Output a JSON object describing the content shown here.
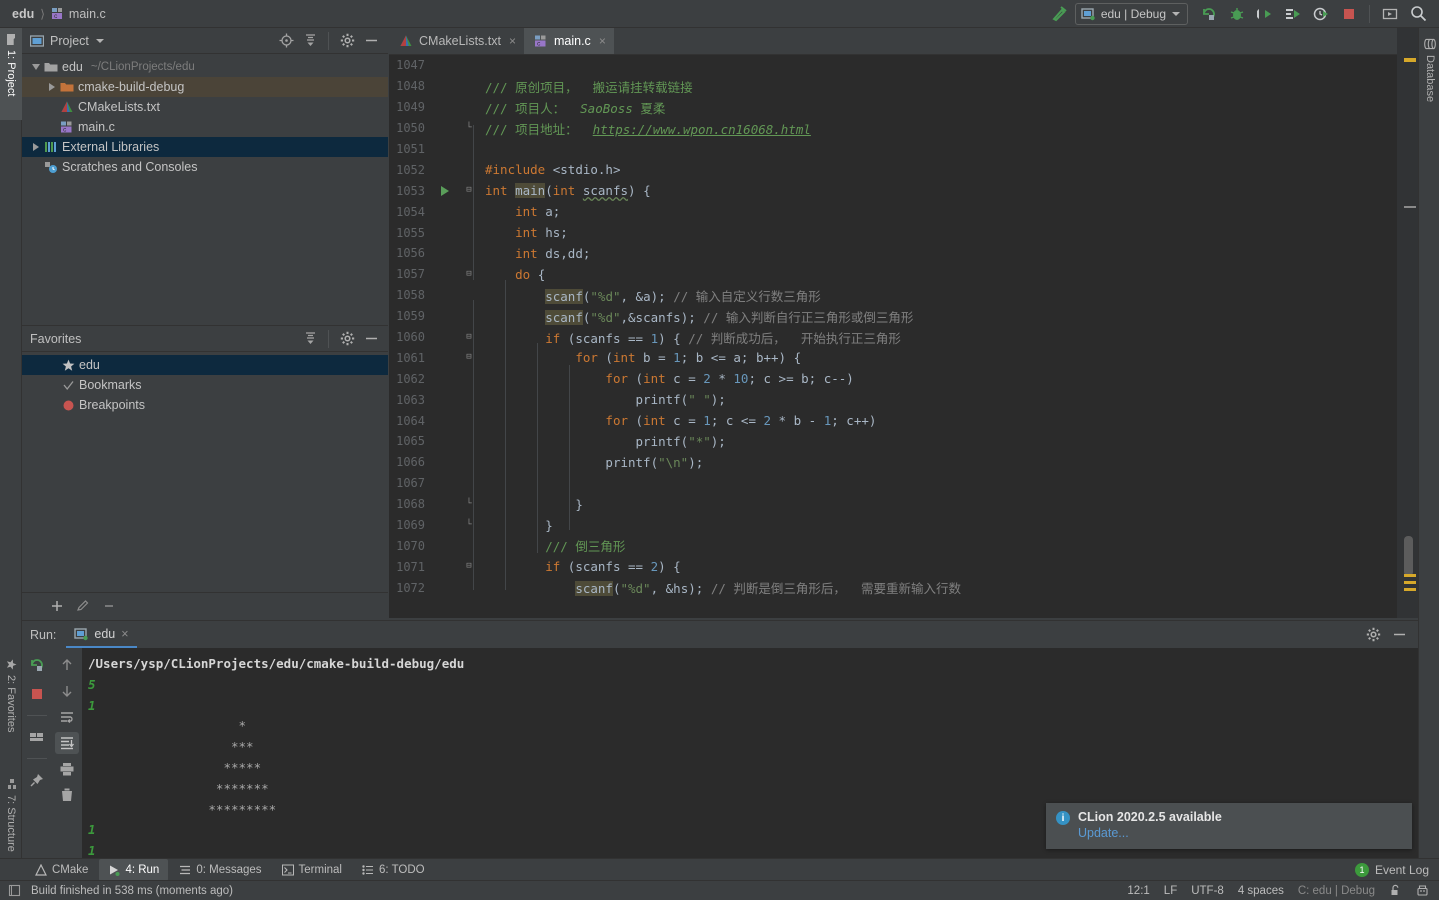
{
  "window": {
    "breadcrumb": [
      {
        "label": "edu",
        "icon": "project-icon",
        "bold": true
      },
      {
        "label": "main.c",
        "icon": "c-file-icon",
        "bold": false
      }
    ]
  },
  "toolbar": {
    "build_icon": "hammer-icon",
    "run_config": {
      "label": "edu | Debug",
      "icon": "run-config-icon",
      "caret": "chevron-down-icon"
    },
    "buttons": [
      {
        "name": "rerun-icon",
        "title": "Rerun"
      },
      {
        "name": "debug-icon",
        "title": "Debug"
      },
      {
        "name": "run-with-coverage-icon",
        "title": "Run with Coverage"
      },
      {
        "name": "profile-icon",
        "title": "Profile"
      },
      {
        "name": "attach-profiler-icon",
        "title": "Attach Profiler"
      },
      {
        "name": "stop-icon",
        "title": "Stop"
      },
      {
        "name": "hide-window-icon",
        "title": "Hide"
      },
      {
        "name": "search-icon",
        "title": "Search Everywhere"
      }
    ]
  },
  "left_strip": {
    "tabs": [
      {
        "label": "1: Project",
        "icon": "project-folder-icon",
        "active": true
      },
      {
        "label": "2: Favorites",
        "icon": "star-icon",
        "active": false
      },
      {
        "label": "7: Structure",
        "icon": "structure-icon",
        "active": false
      }
    ]
  },
  "right_strip": {
    "tabs": [
      {
        "label": "Database",
        "icon": "database-icon",
        "active": false
      }
    ]
  },
  "project_panel": {
    "title": "Project",
    "title_caret": "chevron-down-icon",
    "header_icons": [
      "locate-icon",
      "collapse-all-icon",
      "gear-icon",
      "minimize-icon"
    ],
    "tree": [
      {
        "label": "edu",
        "sub": "~/CLionProjects/edu",
        "icon": "folder-icon",
        "twisty": "down",
        "indent": 0,
        "state": "none"
      },
      {
        "label": "cmake-build-debug",
        "sub": "",
        "icon": "excluded-folder-icon",
        "twisty": "right",
        "indent": 1,
        "state": "soft"
      },
      {
        "label": "CMakeLists.txt",
        "sub": "",
        "icon": "cmake-icon",
        "twisty": "none",
        "indent": 1,
        "state": "none"
      },
      {
        "label": "main.c",
        "sub": "",
        "icon": "c-file-icon",
        "twisty": "none",
        "indent": 1,
        "state": "none"
      },
      {
        "label": "External Libraries",
        "sub": "",
        "icon": "libraries-icon",
        "twisty": "right",
        "indent": 0,
        "state": "blue"
      },
      {
        "label": "Scratches and Consoles",
        "sub": "",
        "icon": "scratches-icon",
        "twisty": "none",
        "indent": 0,
        "state": "none"
      }
    ],
    "bottom_buttons": [
      "add-icon",
      "edit-icon",
      "remove-icon"
    ]
  },
  "favorites_panel": {
    "title": "Favorites",
    "header_icons": [
      "collapse-all-icon",
      "gear-icon",
      "minimize-icon"
    ],
    "items": [
      {
        "label": "edu",
        "icon": "star-icon",
        "state": "blue"
      },
      {
        "label": "Bookmarks",
        "icon": "check-icon",
        "state": "none"
      },
      {
        "label": "Breakpoints",
        "icon": "breakpoint-icon",
        "state": "none"
      }
    ]
  },
  "editor": {
    "tabs": [
      {
        "label": "CMakeLists.txt",
        "icon": "cmake-icon",
        "active": false,
        "close": "×"
      },
      {
        "label": "main.c",
        "icon": "c-file-icon",
        "active": true,
        "close": "×"
      }
    ],
    "first_line": 1047,
    "lines": [
      {
        "num": 1047,
        "fold": "",
        "gutter": "",
        "blank": true,
        "tokens": []
      },
      {
        "num": 1048,
        "fold": "",
        "gutter": "",
        "indent": 0,
        "tokens": [
          {
            "t": "/// 原创项目，  搬运请挂转载链接",
            "c": "doc"
          }
        ]
      },
      {
        "num": 1049,
        "fold": "",
        "gutter": "",
        "indent": 0,
        "tokens": [
          {
            "t": "/// 项目人：  ",
            "c": "doc"
          },
          {
            "t": "SaoBoss",
            "c": "doci"
          },
          {
            "t": " 夏柔",
            "c": "doc"
          }
        ]
      },
      {
        "num": 1050,
        "fold": "end",
        "gutter": "",
        "indent": 0,
        "tokens": [
          {
            "t": "/// 项目地址：  ",
            "c": "doc"
          },
          {
            "t": "https://www.wpon.cn16068.html",
            "c": "lnk"
          }
        ]
      },
      {
        "num": 1051,
        "fold": "",
        "gutter": "",
        "blank": true,
        "tokens": []
      },
      {
        "num": 1052,
        "fold": "",
        "gutter": "",
        "indent": 0,
        "tokens": [
          {
            "t": "#include",
            "c": "k"
          },
          {
            "t": " <stdio.h>",
            "c": "id"
          }
        ]
      },
      {
        "num": 1053,
        "fold": "start",
        "gutter": "run",
        "indent": 0,
        "tokens": [
          {
            "t": "int",
            "c": "k"
          },
          {
            "t": " ",
            "c": "id"
          },
          {
            "t": "main",
            "c": "hl"
          },
          {
            "t": "(",
            "c": "id"
          },
          {
            "t": "int",
            "c": "k"
          },
          {
            "t": " ",
            "c": "id"
          },
          {
            "t": "scanfs",
            "c": "err"
          },
          {
            "t": ") {",
            "c": "id"
          }
        ]
      },
      {
        "num": 1054,
        "fold": "",
        "gutter": "",
        "indent": 1,
        "tokens": [
          {
            "t": "int",
            "c": "k"
          },
          {
            "t": " a;",
            "c": "id"
          }
        ]
      },
      {
        "num": 1055,
        "fold": "",
        "gutter": "",
        "indent": 1,
        "tokens": [
          {
            "t": "int",
            "c": "k"
          },
          {
            "t": " hs;",
            "c": "id"
          }
        ]
      },
      {
        "num": 1056,
        "fold": "",
        "gutter": "",
        "indent": 1,
        "tokens": [
          {
            "t": "int",
            "c": "k"
          },
          {
            "t": " ds,dd;",
            "c": "id"
          }
        ]
      },
      {
        "num": 1057,
        "fold": "start",
        "gutter": "",
        "indent": 1,
        "tokens": [
          {
            "t": "do",
            "c": "k"
          },
          {
            "t": " {",
            "c": "id"
          }
        ]
      },
      {
        "num": 1058,
        "fold": "",
        "gutter": "",
        "indent": 2,
        "tokens": [
          {
            "t": "scanf",
            "c": "hl"
          },
          {
            "t": "(",
            "c": "id"
          },
          {
            "t": "\"%d\"",
            "c": "s"
          },
          {
            "t": ", &a); ",
            "c": "id"
          },
          {
            "t": "// 输入自定义行数三角形",
            "c": "c"
          }
        ]
      },
      {
        "num": 1059,
        "fold": "",
        "gutter": "",
        "indent": 2,
        "tokens": [
          {
            "t": "scanf",
            "c": "hl"
          },
          {
            "t": "(",
            "c": "id"
          },
          {
            "t": "\"%d\"",
            "c": "s"
          },
          {
            "t": ",&scanfs); ",
            "c": "id"
          },
          {
            "t": "// 输入判断自行正三角形或倒三角形",
            "c": "c"
          }
        ]
      },
      {
        "num": 1060,
        "fold": "start",
        "gutter": "",
        "indent": 2,
        "tokens": [
          {
            "t": "if",
            "c": "k"
          },
          {
            "t": " (scanfs == ",
            "c": "id"
          },
          {
            "t": "1",
            "c": "n"
          },
          {
            "t": ") { ",
            "c": "id"
          },
          {
            "t": "// 判断成功后，  开始执行正三角形",
            "c": "c"
          }
        ]
      },
      {
        "num": 1061,
        "fold": "start",
        "gutter": "",
        "indent": 3,
        "tokens": [
          {
            "t": "for",
            "c": "k"
          },
          {
            "t": " (",
            "c": "id"
          },
          {
            "t": "int",
            "c": "k"
          },
          {
            "t": " b = ",
            "c": "id"
          },
          {
            "t": "1",
            "c": "n"
          },
          {
            "t": "; b <= a; b++) {",
            "c": "id"
          }
        ]
      },
      {
        "num": 1062,
        "fold": "",
        "gutter": "",
        "indent": 4,
        "tokens": [
          {
            "t": "for",
            "c": "k"
          },
          {
            "t": " (",
            "c": "id"
          },
          {
            "t": "int",
            "c": "k"
          },
          {
            "t": " c = ",
            "c": "id"
          },
          {
            "t": "2",
            "c": "n"
          },
          {
            "t": " * ",
            "c": "id"
          },
          {
            "t": "10",
            "c": "n"
          },
          {
            "t": "; c >= b; c--)",
            "c": "id"
          }
        ]
      },
      {
        "num": 1063,
        "fold": "",
        "gutter": "",
        "indent": 5,
        "tokens": [
          {
            "t": "printf(",
            "c": "id"
          },
          {
            "t": "\" \"",
            "c": "s"
          },
          {
            "t": ");",
            "c": "id"
          }
        ]
      },
      {
        "num": 1064,
        "fold": "",
        "gutter": "",
        "indent": 4,
        "tokens": [
          {
            "t": "for",
            "c": "k"
          },
          {
            "t": " (",
            "c": "id"
          },
          {
            "t": "int",
            "c": "k"
          },
          {
            "t": " c = ",
            "c": "id"
          },
          {
            "t": "1",
            "c": "n"
          },
          {
            "t": "; c <= ",
            "c": "id"
          },
          {
            "t": "2",
            "c": "n"
          },
          {
            "t": " * b - ",
            "c": "id"
          },
          {
            "t": "1",
            "c": "n"
          },
          {
            "t": "; c++)",
            "c": "id"
          }
        ]
      },
      {
        "num": 1065,
        "fold": "",
        "gutter": "",
        "indent": 5,
        "tokens": [
          {
            "t": "printf(",
            "c": "id"
          },
          {
            "t": "\"*\"",
            "c": "s"
          },
          {
            "t": ");",
            "c": "id"
          }
        ]
      },
      {
        "num": 1066,
        "fold": "",
        "gutter": "",
        "indent": 4,
        "tokens": [
          {
            "t": "printf(",
            "c": "id"
          },
          {
            "t": "\"\\n\"",
            "c": "s"
          },
          {
            "t": ");",
            "c": "id"
          }
        ]
      },
      {
        "num": 1067,
        "fold": "",
        "gutter": "",
        "blank": true,
        "tokens": []
      },
      {
        "num": 1068,
        "fold": "end",
        "gutter": "",
        "indent": 3,
        "tokens": [
          {
            "t": "}",
            "c": "id"
          }
        ]
      },
      {
        "num": 1069,
        "fold": "end",
        "gutter": "",
        "indent": 2,
        "tokens": [
          {
            "t": "}",
            "c": "id"
          }
        ]
      },
      {
        "num": 1070,
        "fold": "",
        "gutter": "",
        "indent": 2,
        "tokens": [
          {
            "t": "/// 倒三角形",
            "c": "doc"
          }
        ]
      },
      {
        "num": 1071,
        "fold": "start",
        "gutter": "",
        "indent": 2,
        "tokens": [
          {
            "t": "if",
            "c": "k"
          },
          {
            "t": " (scanfs == ",
            "c": "id"
          },
          {
            "t": "2",
            "c": "n"
          },
          {
            "t": ") {",
            "c": "id"
          }
        ]
      },
      {
        "num": 1072,
        "fold": "",
        "gutter": "",
        "indent": 3,
        "tokens": [
          {
            "t": "scanf",
            "c": "hl"
          },
          {
            "t": "(",
            "c": "id"
          },
          {
            "t": "\"%d\"",
            "c": "s"
          },
          {
            "t": ", &hs); ",
            "c": "id"
          },
          {
            "t": "// 判断是倒三角形后，  需要重新输入行数",
            "c": "c"
          }
        ]
      }
    ]
  },
  "run_panel": {
    "label": "Run:",
    "tab": {
      "label": "edu",
      "icon": "run-config-icon",
      "close": "×"
    },
    "header_icons": [
      "gear-icon",
      "minimize-icon"
    ],
    "left_tools": [
      "rerun-icon",
      "stop-icon",
      "restore-layout-icon",
      "pin-icon"
    ],
    "right_tools": [
      "scroll-up-icon",
      "scroll-down-icon",
      "soft-wrap-icon",
      "scroll-to-end-icon",
      "print-icon",
      "clear-all-icon"
    ],
    "console": [
      {
        "text": "/Users/ysp/CLionProjects/edu/cmake-build-debug/edu",
        "style": "path"
      },
      {
        "text": "5",
        "style": "input"
      },
      {
        "text": "1",
        "style": "input"
      },
      {
        "text": "                    *",
        "style": "out"
      },
      {
        "text": "                   ***",
        "style": "out"
      },
      {
        "text": "                  *****",
        "style": "out"
      },
      {
        "text": "                 *******",
        "style": "out"
      },
      {
        "text": "                *********",
        "style": "out"
      },
      {
        "text": "1",
        "style": "input"
      },
      {
        "text": "1",
        "style": "input"
      }
    ]
  },
  "notification": {
    "icon": "info-icon",
    "title": "CLion 2020.2.5 available",
    "link": "Update..."
  },
  "bottom_toolbar": {
    "items": [
      {
        "label": "CMake",
        "icon": "cmake-icon",
        "active": false,
        "mnemonic": ""
      },
      {
        "label": "4: Run",
        "icon": "run-icon",
        "active": true,
        "mnemonic": "4"
      },
      {
        "label": "0: Messages",
        "icon": "messages-icon",
        "active": false,
        "mnemonic": "0"
      },
      {
        "label": "Terminal",
        "icon": "terminal-icon",
        "active": false,
        "mnemonic": ""
      },
      {
        "label": "6: TODO",
        "icon": "todo-icon",
        "active": false,
        "mnemonic": "6"
      }
    ],
    "event_log": {
      "label": "Event Log",
      "count": "1"
    }
  },
  "status_bar": {
    "icon": "memory-icon",
    "message": "Build finished in 538 ms (moments ago)",
    "caret": "12:1",
    "line_sep": "LF",
    "encoding": "UTF-8",
    "indent": "4 spaces",
    "branch": "C: edu | Debug",
    "icons": [
      "lock-icon",
      "inspection-icon"
    ]
  },
  "colors": {
    "accent_blue": "#4a88c7",
    "selection_blue": "#0d293e",
    "panel_bg": "#3c3f41",
    "editor_bg": "#2b2b2b",
    "green": "#499c54",
    "red": "#c75450"
  }
}
